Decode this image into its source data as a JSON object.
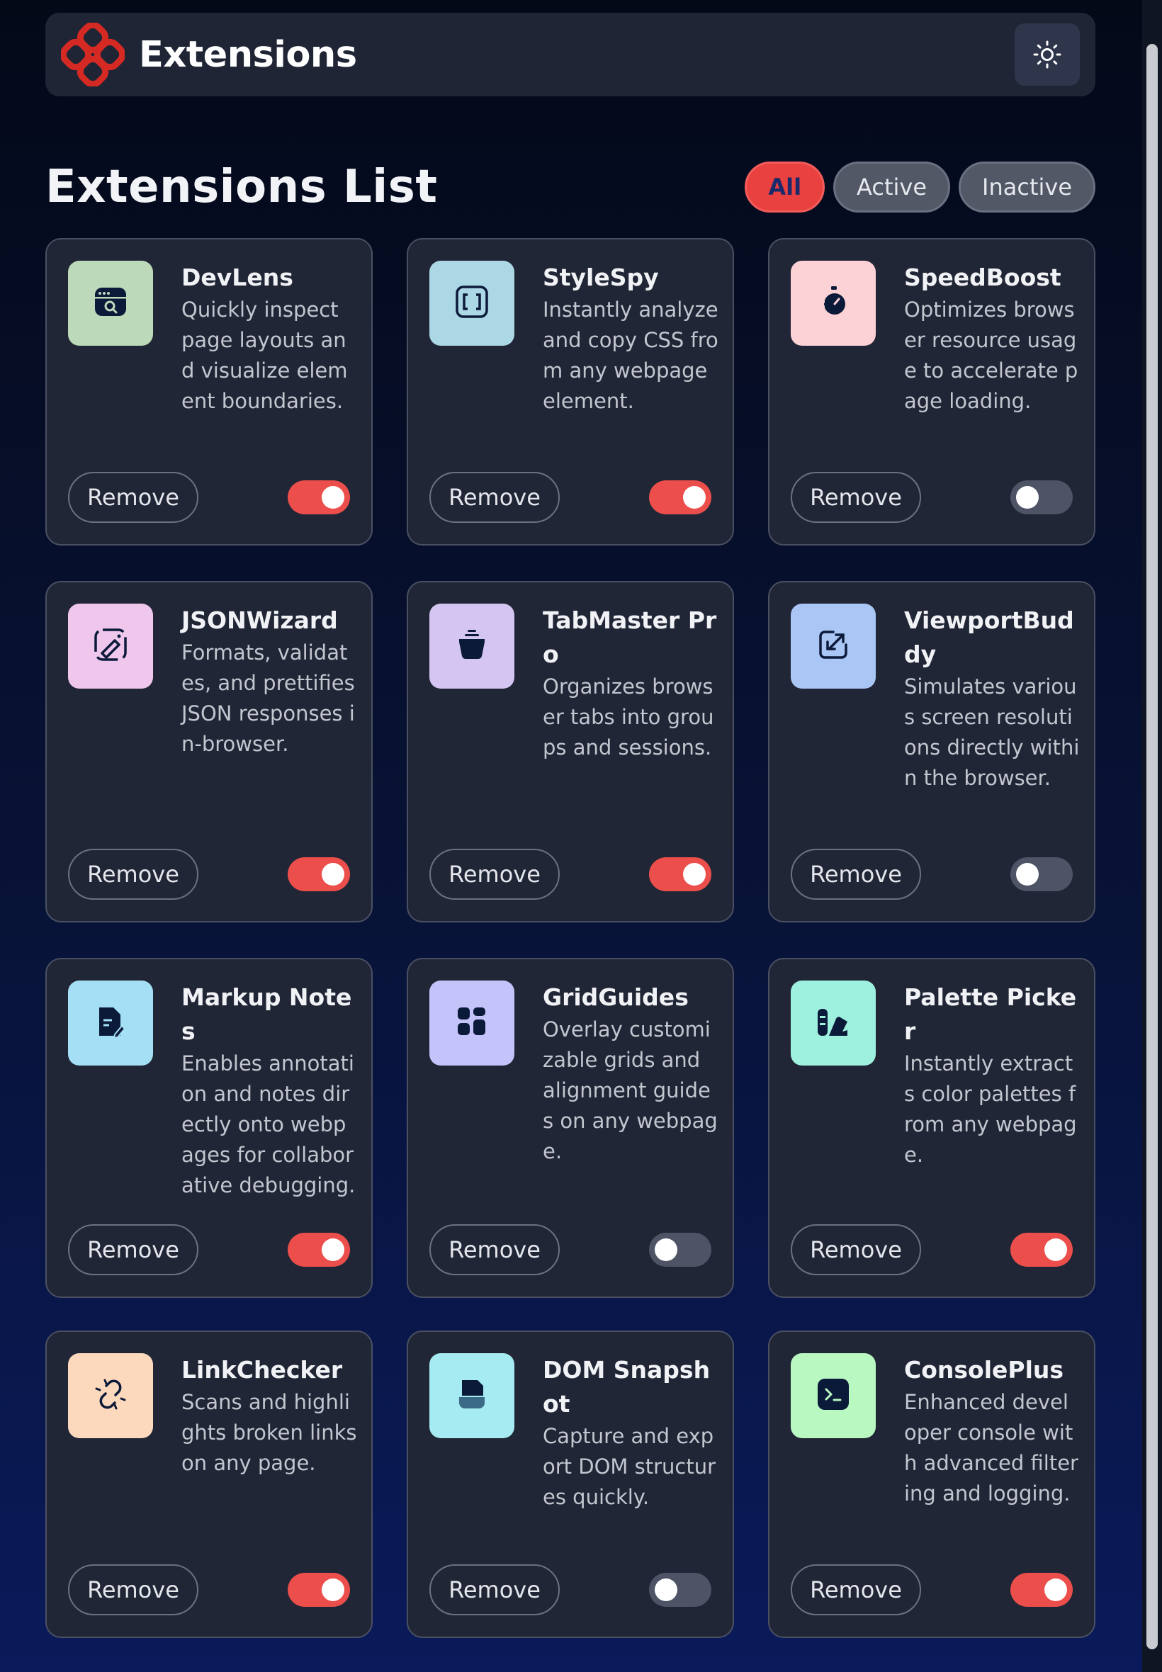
{
  "header": {
    "brand": "Extensions",
    "logo_icon": "extensions-logo-icon",
    "theme_icon": "sun-icon",
    "accent_color": "#e9413f"
  },
  "section": {
    "title": "Extensions List",
    "filters": [
      "All",
      "Active",
      "Inactive"
    ],
    "selected_filter": "All"
  },
  "extensions": [
    {
      "name": "DevLens",
      "description": "Quickly inspect page layouts and visualize element boundaries.",
      "remove_label": "Remove",
      "active": true,
      "icon": "devlens-icon",
      "tile_color": "#bcd9b9"
    },
    {
      "name": "StyleSpy",
      "description": "Instantly analyze and copy CSS from any webpage element.",
      "remove_label": "Remove",
      "active": true,
      "icon": "stylespy-icon",
      "tile_color": "#acd7e5"
    },
    {
      "name": "SpeedBoost",
      "description": "Optimizes browser resource usage to accelerate page loading.",
      "remove_label": "Remove",
      "active": false,
      "icon": "speedboost-icon",
      "tile_color": "#fcd2d6"
    },
    {
      "name": "JSONWizard",
      "description": "Formats, validates, and prettifies JSON responses in-browser.",
      "remove_label": "Remove",
      "active": true,
      "icon": "jsonwizard-icon",
      "tile_color": "#efc7ec"
    },
    {
      "name": "TabMaster Pro",
      "description": "Organizes browser tabs into groups and sessions.",
      "remove_label": "Remove",
      "active": true,
      "icon": "tabmaster-icon",
      "tile_color": "#d4c5f2"
    },
    {
      "name": "ViewportBuddy",
      "description": "Simulates various screen resolutions directly within the browser.",
      "remove_label": "Remove",
      "active": false,
      "icon": "viewportbuddy-icon",
      "tile_color": "#a9c6f5"
    },
    {
      "name": "Markup Notes",
      "description": "Enables annotation and notes directly onto webpages for collaborative debugging.",
      "remove_label": "Remove",
      "active": true,
      "icon": "markupnotes-icon",
      "tile_color": "#a5dff6"
    },
    {
      "name": "GridGuides",
      "description": "Overlay customizable grids and alignment guides on any webpage.",
      "remove_label": "Remove",
      "active": false,
      "icon": "gridguides-icon",
      "tile_color": "#c4c4fa"
    },
    {
      "name": "Palette Picker",
      "description": "Instantly extracts color palettes from any webpage.",
      "remove_label": "Remove",
      "active": true,
      "icon": "palettepicker-icon",
      "tile_color": "#9ff1df"
    },
    {
      "name": "LinkChecker",
      "description": "Scans and highlights broken links on any page.",
      "remove_label": "Remove",
      "active": true,
      "icon": "linkchecker-icon",
      "tile_color": "#fcd8bd"
    },
    {
      "name": "DOM Snapshot",
      "description": "Capture and export DOM structures quickly.",
      "remove_label": "Remove",
      "active": false,
      "icon": "domsnapshot-icon",
      "tile_color": "#a6eaf2"
    },
    {
      "name": "ConsolePlus",
      "description": "Enhanced developer console with advanced filtering and logging.",
      "remove_label": "Remove",
      "active": true,
      "icon": "consoleplus-icon",
      "tile_color": "#b9f8c1"
    }
  ]
}
